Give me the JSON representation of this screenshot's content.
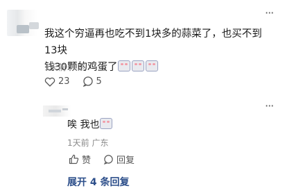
{
  "comment": {
    "text_line1": "我这个穷逼再也吃不到1块多的蒜菜了，也买不到13块",
    "text_line2": "钱30颗的鸡蛋了",
    "meta_time": "1天前",
    "meta_location": "广东",
    "likes": "23",
    "comments": "5"
  },
  "reply": {
    "text": "唉 我也",
    "meta_time": "1天前",
    "meta_location": "广东",
    "like_label": "赞",
    "reply_label": "回复"
  },
  "expand_label": "展开 4 条回复",
  "icons": {
    "more": "more-dots-icon",
    "like": "heart-icon",
    "comment": "comment-bubble-icon",
    "thumb": "thumbs-up-icon",
    "reply": "reply-bubble-icon",
    "emoji": "blushing-face-emoji"
  },
  "colors": {
    "text": "#1a1a1a",
    "meta": "#8a8a8a",
    "link": "#2c4e8a"
  }
}
